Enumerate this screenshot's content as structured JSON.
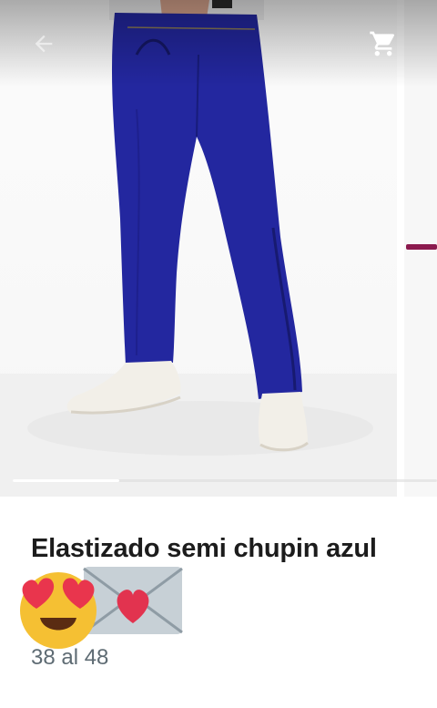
{
  "product": {
    "title": "Elastizado semi chupin azul",
    "emojis": [
      "smiling-face-with-heart-eyes",
      "love-letter"
    ],
    "sizes": "38 al 48"
  },
  "gallery": {
    "image_count": 4,
    "current_index": 1,
    "next_image_accent_color": "#8b1a4e"
  },
  "toolbar": {
    "back_icon": "arrow-back-icon",
    "cart_icon": "shopping-cart-icon"
  },
  "colors": {
    "jeans": "#23279f",
    "title_text": "#1c1c1c",
    "subtitle_text": "#5e6b73"
  }
}
